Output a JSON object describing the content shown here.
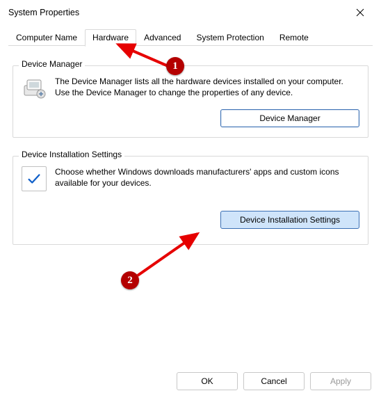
{
  "window": {
    "title": "System Properties"
  },
  "tabs": [
    {
      "label": "Computer Name",
      "active": false
    },
    {
      "label": "Hardware",
      "active": true
    },
    {
      "label": "Advanced",
      "active": false
    },
    {
      "label": "System Protection",
      "active": false
    },
    {
      "label": "Remote",
      "active": false
    }
  ],
  "deviceManager": {
    "legend": "Device Manager",
    "description": "The Device Manager lists all the hardware devices installed on your computer. Use the Device Manager to change the properties of any device.",
    "button": "Device Manager"
  },
  "installSettings": {
    "legend": "Device Installation Settings",
    "description": "Choose whether Windows downloads manufacturers' apps and custom icons available for your devices.",
    "button": "Device Installation Settings"
  },
  "footer": {
    "ok": "OK",
    "cancel": "Cancel",
    "apply": "Apply"
  },
  "callouts": {
    "one": "1",
    "two": "2"
  }
}
